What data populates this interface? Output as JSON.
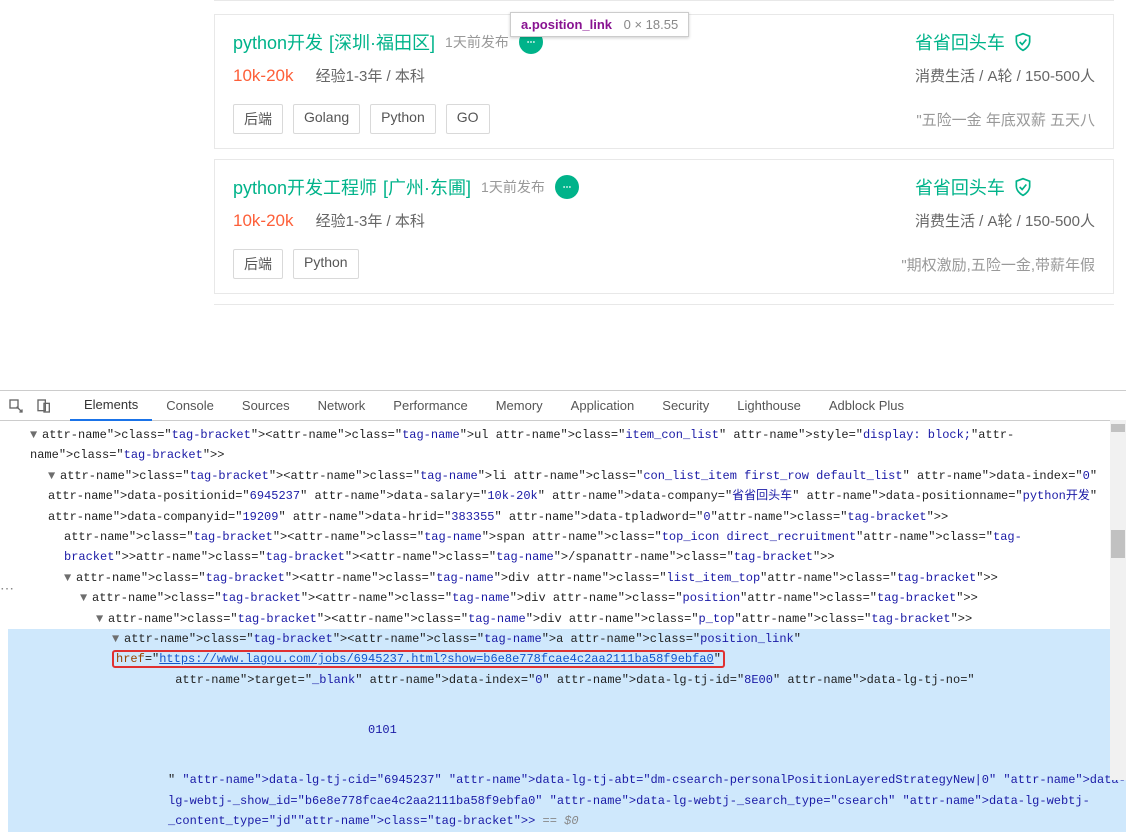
{
  "tooltip": {
    "selector": "a.position_link",
    "dimensions": "0 × 18.55"
  },
  "jobs": [
    {
      "title": "python开发",
      "location": "[深圳·福田区]",
      "time": "1天前发布",
      "salary": "10k-20k",
      "exp": "经验1-3年 / 本科",
      "company": "省省回头车",
      "company_meta": "消费生活 / A轮 / 150-500人",
      "tags": [
        "后端",
        "Golang",
        "Python",
        "GO"
      ],
      "benefits": "\"五险一金 年底双薪 五天八"
    },
    {
      "title": "python开发工程师",
      "location": "[广州·东圃]",
      "time": "1天前发布",
      "salary": "10k-20k",
      "exp": "经验1-3年 / 本科",
      "company": "省省回头车",
      "company_meta": "消费生活 / A轮 / 150-500人",
      "tags": [
        "后端",
        "Python"
      ],
      "benefits": "\"期权激励,五险一金,带薪年假"
    }
  ],
  "devtools": {
    "tabs": [
      "Elements",
      "Console",
      "Sources",
      "Network",
      "Performance",
      "Memory",
      "Application",
      "Security",
      "Lighthouse",
      "Adblock Plus"
    ],
    "active_tab": "Elements",
    "code": {
      "l1_open": "<ul class=\"item_con_list\" style=\"display: block;\">",
      "l2_li": "<li class=\"con_list_item first_row default_list\" data-index=\"0\" data-positionid=\"6945237\" data-salary=\"10k-20k\" data-company=\"省省回头车\" data-positionname=\"python开发\" data-companyid=\"19209\" data-hrid=\"383355\" data-tpladword=\"0\">",
      "l3_span": "<span class=\"top_icon direct_recruitment\"></span>",
      "l4_div": "<div class=\"list_item_top\">",
      "l5_div": "<div class=\"position\">",
      "l6_div": "<div class=\"p_top\">",
      "l7_a_pre": "<a class=\"position_link\" ",
      "l7_href_attr": "href",
      "l7_href_val": "https://www.lagou.com/jobs/6945237.html?show=b6e8e778fcae4c2aa2111ba58f9ebfa0",
      "l7_rest1": " target=\"_blank\" data-index=\"0\" data-lg-tj-id=\"8E00\" data-lg-tj-no=\"",
      "l7_rest2": "0101",
      "l7_rest3": "\" data-lg-tj-cid=\"6945237\" data-lg-tj-abt=\"dm-csearch-personalPositionLayeredStrategyNew|0\" data-lg-webtj-_show_id=\"b6e8e778fcae4c2aa2111ba58f9ebfa0\" data-lg-webtj-_search_type=\"csearch\" data-lg-webtj-_content_type=\"jd\">",
      "dollar0": " == $0"
    }
  }
}
